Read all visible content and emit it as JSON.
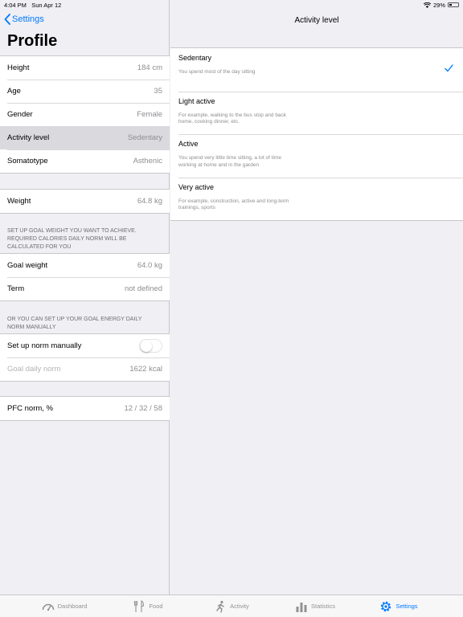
{
  "status": {
    "time": "4:04 PM",
    "date": "Sun Apr 12",
    "battery": "29%"
  },
  "nav": {
    "back_label": "Settings",
    "title": "Profile"
  },
  "body_section": [
    {
      "label": "Height",
      "value": "184 cm"
    },
    {
      "label": "Age",
      "value": "35"
    },
    {
      "label": "Gender",
      "value": "Female"
    },
    {
      "label": "Activity level",
      "value": "Sedentary"
    },
    {
      "label": "Somatotype",
      "value": "Asthenic"
    }
  ],
  "weight": {
    "label": "Weight",
    "value": "64.8 kg"
  },
  "goal_footer": "SET UP GOAL WEIGHT YOU WANT TO ACHIEVE. REQUIRED CALORIES DAILY NORM WILL BE CALCULATED FOR YOU",
  "goal_section": [
    {
      "label": "Goal weight",
      "value": "64.0 kg"
    },
    {
      "label": "Term",
      "value": "not defined"
    }
  ],
  "norm_footer": "OR YOU CAN SET UP YOUR GOAL ENERGY DAILY NORM MANUALLY",
  "norm_section": {
    "manual_label": "Set up norm manually",
    "manual_on": false,
    "goal_norm_label": "Goal daily norm",
    "goal_norm_value": "1622 kcal"
  },
  "pfc": {
    "label": "PFC norm, %",
    "value": "12 / 32 / 58"
  },
  "detail": {
    "title": "Activity level",
    "selected_index": 0,
    "options": [
      {
        "title": "Sedentary",
        "desc": "You spend most of the day sitting"
      },
      {
        "title": "Light active",
        "desc": "For example, walking to the bus stop and back home, cooking dinner, etc."
      },
      {
        "title": "Active",
        "desc": "You spend very little time sitting, a lot of time working at home and in the garden"
      },
      {
        "title": "Very active",
        "desc": "For example, construction, active and long-term trainings, sports"
      }
    ]
  },
  "tabs": [
    {
      "label": "Dashboard",
      "icon": "gauge-icon"
    },
    {
      "label": "Food",
      "icon": "fork-knife-icon"
    },
    {
      "label": "Activity",
      "icon": "runner-icon"
    },
    {
      "label": "Statistics",
      "icon": "bar-chart-icon"
    },
    {
      "label": "Settings",
      "icon": "gear-icon"
    }
  ],
  "colors": {
    "accent": "#007aff",
    "selected_row": "#d9d9de",
    "background": "#efeff4"
  }
}
